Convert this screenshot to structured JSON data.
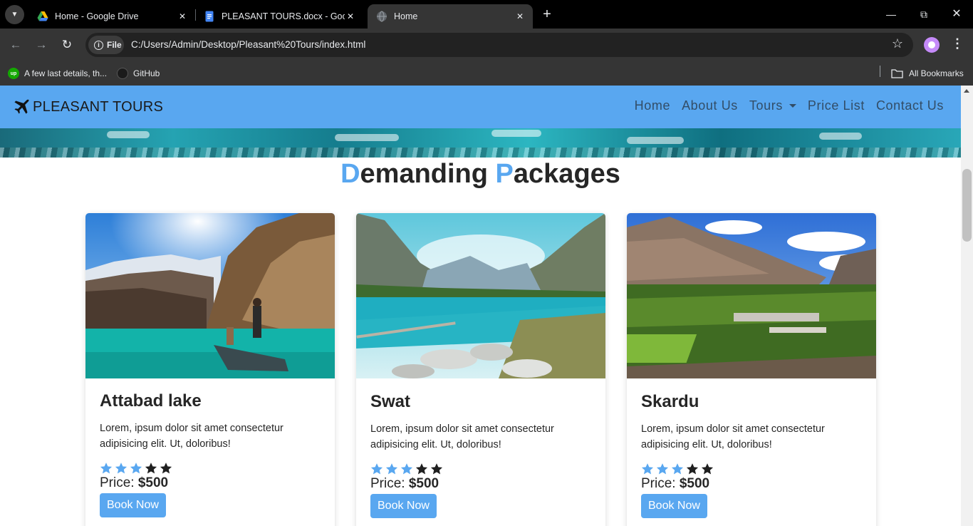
{
  "browser": {
    "tabs": [
      {
        "title": "Home - Google Drive",
        "icon": "google-drive-icon"
      },
      {
        "title": "PLEASANT TOURS.docx - Goog",
        "icon": "google-docs-icon"
      },
      {
        "title": "Home",
        "icon": "globe-icon"
      }
    ],
    "chip_label": "File",
    "url": "C:/Users/Admin/Desktop/Pleasant%20Tours/index.html",
    "bookmarks": [
      {
        "label": "A few last details, th...",
        "icon": "upwork-icon"
      },
      {
        "label": "GitHub",
        "icon": "github-icon"
      }
    ],
    "all_bookmarks": "All Bookmarks"
  },
  "site": {
    "brand": "PLEASANT TOURS",
    "nav": [
      "Home",
      "About Us",
      "Tours",
      "Price List",
      "Contact Us"
    ],
    "section_title": {
      "first_letter": "D",
      "rest1": "emanding ",
      "second_letter": "P",
      "rest2": "ackages"
    },
    "accent_color": "#59a7f0",
    "cards": [
      {
        "title": "Attabad lake",
        "text": "Lorem, ipsum dolor sit amet consectetur adipisicing elit. Ut, doloribus!",
        "rating": 3,
        "max_rating": 5,
        "price_label": "Price:",
        "price": "$500",
        "button": "Book Now"
      },
      {
        "title": "Swat",
        "text": "Lorem, ipsum dolor sit amet consectetur adipisicing elit. Ut, doloribus!",
        "rating": 3,
        "max_rating": 5,
        "price_label": "Price:",
        "price": "$500",
        "button": "Book Now"
      },
      {
        "title": "Skardu",
        "text": "Lorem, ipsum dolor sit amet consectetur adipisicing elit. Ut, doloribus!",
        "rating": 3,
        "max_rating": 5,
        "price_label": "Price:",
        "price": "$500",
        "button": "Book Now"
      }
    ]
  }
}
